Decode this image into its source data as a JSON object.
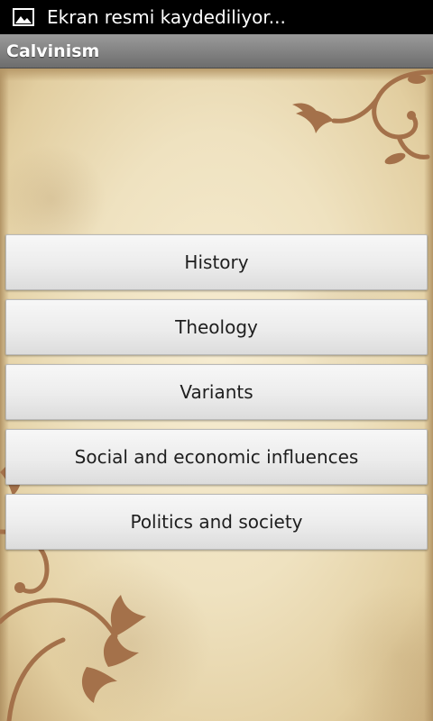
{
  "status_bar": {
    "notification_icon": "image-icon",
    "notification_text": "Ekran resmi kaydediliyor..."
  },
  "app": {
    "title": "Calvinism"
  },
  "menu": {
    "items": [
      {
        "label": "History"
      },
      {
        "label": "Theology"
      },
      {
        "label": "Variants"
      },
      {
        "label": "Social and economic influences"
      },
      {
        "label": "Politics and society"
      }
    ]
  },
  "colors": {
    "status_bar_bg": "#000000",
    "title_bar_bg": "#8a8a8a",
    "parchment": "#efe2c0",
    "ornament": "#a4714a",
    "button_bg": "#ececec",
    "button_text": "#1e1e1e"
  }
}
